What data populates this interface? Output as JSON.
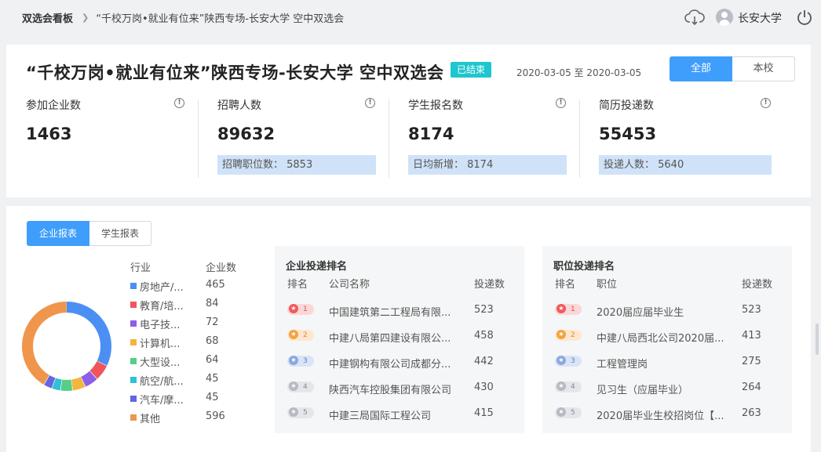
{
  "breadcrumb": {
    "root": "双选会看板",
    "current": "“千校万岗•就业有位来”陕西专场-长安大学 空中双选会"
  },
  "header": {
    "user_name": "长安大学"
  },
  "event": {
    "title": "“千校万岗•就业有位来”陕西专场-长安大学 空中双选会",
    "status": "已结束",
    "date_range": "2020-03-05 至 2020-03-05",
    "scope_toggle": {
      "all": "全部",
      "own": "本校",
      "selected": "全部"
    }
  },
  "stats": [
    {
      "label": "参加企业数",
      "value": "1463",
      "sub": ""
    },
    {
      "label": "招聘人数",
      "value": "89632",
      "sub": "招聘职位数： 5853"
    },
    {
      "label": "学生报名数",
      "value": "8174",
      "sub": "日均新增： 8174"
    },
    {
      "label": "简历投递数",
      "value": "55453",
      "sub": "投递人数： 5640"
    }
  ],
  "report_tabs": {
    "enterprise": "企业报表",
    "student": "学生报表",
    "selected": "企业报表"
  },
  "industry": {
    "header_name": "行业",
    "header_count": "企业数",
    "rows": [
      {
        "name": "房地产/...",
        "count": "465",
        "color": "#4b8ff5"
      },
      {
        "name": "教育/培...",
        "count": "84",
        "color": "#f0555d"
      },
      {
        "name": "电子技...",
        "count": "72",
        "color": "#8c5fe6"
      },
      {
        "name": "计算机...",
        "count": "68",
        "color": "#f2b53d"
      },
      {
        "name": "大型设...",
        "count": "64",
        "color": "#56cf85"
      },
      {
        "name": "航空/航...",
        "count": "45",
        "color": "#2ec1d8"
      },
      {
        "name": "汽车/摩...",
        "count": "45",
        "color": "#6366e0"
      },
      {
        "name": "其他",
        "count": "596",
        "color": "#f0954c"
      }
    ]
  },
  "chart_data": {
    "type": "pie",
    "categories": [
      "房地产/...",
      "教育/培...",
      "电子技...",
      "计算机...",
      "大型设...",
      "航空/航...",
      "汽车/摩...",
      "其他"
    ],
    "values": [
      465,
      84,
      72,
      68,
      64,
      45,
      45,
      596
    ],
    "colors": [
      "#4b8ff5",
      "#f0555d",
      "#8c5fe6",
      "#f2b53d",
      "#56cf85",
      "#2ec1d8",
      "#6366e0",
      "#f0954c"
    ],
    "style": "donut",
    "title": ""
  },
  "company_rank": {
    "title": "企业投递排名",
    "headers": {
      "rank": "排名",
      "name": "公司名称",
      "count": "投递数"
    },
    "rows": [
      {
        "rank": "1",
        "name": "中国建筑第二工程局有限...",
        "count": "523"
      },
      {
        "rank": "2",
        "name": "中建八局第四建设有限公...",
        "count": "458"
      },
      {
        "rank": "3",
        "name": "中建钢构有限公司成都分...",
        "count": "442"
      },
      {
        "rank": "4",
        "name": "陕西汽车控股集团有限公司",
        "count": "430"
      },
      {
        "rank": "5",
        "name": "中建三局国际工程公司",
        "count": "415"
      }
    ]
  },
  "position_rank": {
    "title": "职位投递排名",
    "headers": {
      "rank": "排名",
      "name": "职位",
      "count": "投递数"
    },
    "rows": [
      {
        "rank": "1",
        "name": "2020届应届毕业生",
        "count": "523"
      },
      {
        "rank": "2",
        "name": "中建八局西北公司2020届...",
        "count": "413"
      },
      {
        "rank": "3",
        "name": "工程管理岗",
        "count": "275"
      },
      {
        "rank": "4",
        "name": "见习生（应届毕业）",
        "count": "264"
      },
      {
        "rank": "5",
        "name": "2020届毕业生校招岗位【...",
        "count": "263"
      }
    ]
  }
}
